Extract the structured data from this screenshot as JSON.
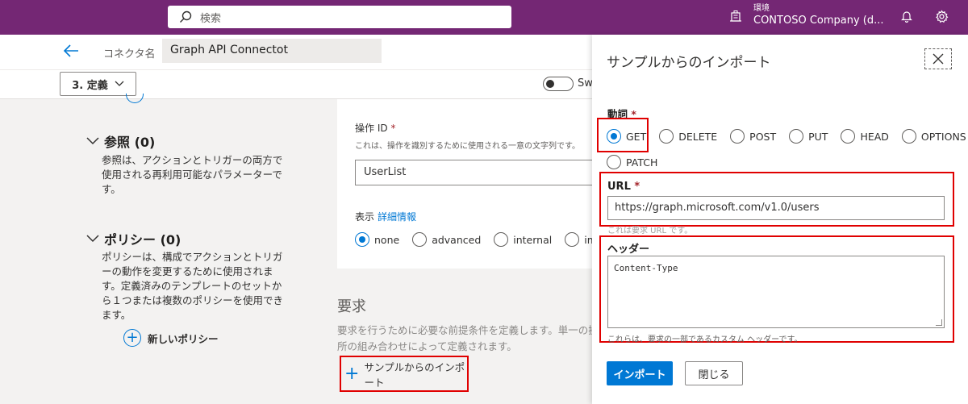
{
  "topbar": {
    "search_placeholder": "検索",
    "environment_label": "環境",
    "environment_value": "CONTOSO Company (d..."
  },
  "header": {
    "connector_label": "コネクタ名",
    "connector_name": "Graph API Connectot"
  },
  "steps": {
    "current": "3. 定義",
    "toggle_label": "Swa"
  },
  "references": {
    "title": "参照 (0)",
    "description": "参照は、アクションとトリガーの両方で使用される再利用可能なパラメーターです。"
  },
  "policies": {
    "title": "ポリシー (0)",
    "description": "ポリシーは、構成でアクションとトリガーの動作を変更するために使用されます。定義済みのテンプレートのセットから１つまたは複数のポリシーを使用できます。",
    "new_label": "新しいポリシー"
  },
  "operation": {
    "id_label": "操作 ID",
    "required_mark": "*",
    "id_description": "これは、操作を識別するために使用される一意の文字列です。",
    "id_value": "UserList",
    "visibility_label": "表示",
    "visibility_link": "詳細情報",
    "visibility_options": [
      "none",
      "advanced",
      "internal",
      "importa"
    ]
  },
  "request": {
    "title": "要求",
    "description_line1": "要求を行うために必要な前提条件を定義します。単一の操",
    "description_line2": "所の組み合わせによって定義されます。",
    "import_label": "サンプルからのインポート"
  },
  "panel": {
    "title": "サンプルからのインポート",
    "verb_label": "動詞",
    "required_mark": "*",
    "verbs": [
      "GET",
      "DELETE",
      "POST",
      "PUT",
      "HEAD",
      "OPTIONS",
      "PATCH"
    ],
    "selected_verb": "GET",
    "url_label": "URL",
    "url_value": "https://graph.microsoft.com/v1.0/users",
    "url_hint": "これは要求 URL です。",
    "headers_label": "ヘッダー",
    "headers_value": "Content-Type",
    "headers_hint": "これらは、要求の一部であるカスタム ヘッダーです。",
    "import_button": "インポート",
    "close_button": "閉じる"
  },
  "colors": {
    "topbar": "#742774",
    "accent": "#0078d4",
    "highlight": "#e00000"
  }
}
